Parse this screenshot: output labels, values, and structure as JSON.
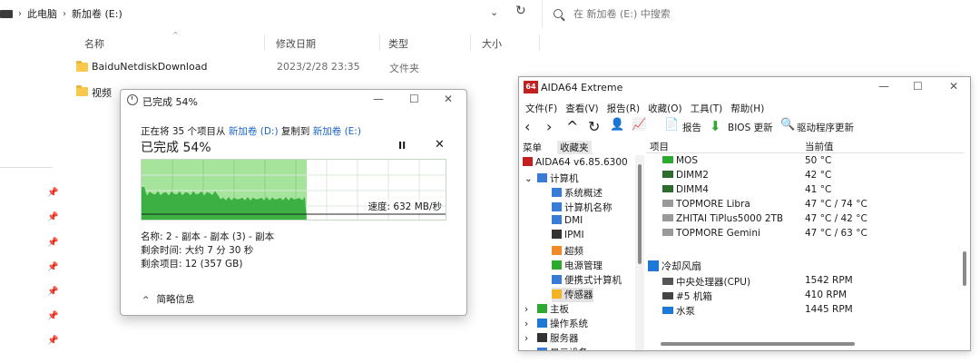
{
  "explorer": {
    "breadcrumb": [
      "此电脑",
      "新加卷 (E:)"
    ],
    "search_placeholder": "在 新加卷 (E:) 中搜索",
    "columns": {
      "name": "名称",
      "date": "修改日期",
      "type": "类型",
      "size": "大小"
    },
    "files": [
      {
        "name": "BaiduNetdiskDownload",
        "date": "2023/2/28 23:35",
        "type": "文件夹"
      },
      {
        "name": "视频",
        "date": "",
        "type": ""
      }
    ]
  },
  "copy_dialog": {
    "title": "已完成 54%",
    "desc_prefix": "正在将 35 个项目从",
    "source": "新加卷 (D:)",
    "desc_mid": "复制到",
    "dest": "新加卷 (E:)",
    "percent_label": "已完成 54%",
    "progress": 0.54,
    "speed": "速度: 632 MB/秒",
    "name_line": "名称: 2 - 副本 - 副本 (3) - 副本",
    "time_line": "剩余时间: 大约 7 分 30 秒",
    "items_line": "剩余项目: 12 (357 GB)",
    "details_label": "简略信息",
    "pause_glyph": "II",
    "stop_glyph": "✕",
    "colors": {
      "fill": "#a6e49c",
      "area": "#3cb043"
    }
  },
  "aida": {
    "logo": "64",
    "title": "AIDA64 Extreme",
    "menu": [
      "文件(F)",
      "查看(V)",
      "报告(R)",
      "收藏(O)",
      "工具(T)",
      "帮助(H)"
    ],
    "toolbar": {
      "report": "报告",
      "bios": "BIOS 更新",
      "driver": "驱动程序更新"
    },
    "tabs": {
      "menu": "菜单",
      "favorites": "收藏夹"
    },
    "tree": [
      {
        "label": "AIDA64 v6.85.6300",
        "level": 0,
        "icon": "aida-icon"
      },
      {
        "label": "计算机",
        "level": 1,
        "icon": "computer-icon",
        "expander": "⌄"
      },
      {
        "label": "系统概述",
        "level": 2,
        "icon": "system-icon"
      },
      {
        "label": "计算机名称",
        "level": 2,
        "icon": "computer-name-icon"
      },
      {
        "label": "DMI",
        "level": 2,
        "icon": "dmi-icon"
      },
      {
        "label": "IPMI",
        "level": 2,
        "icon": "ipmi-icon"
      },
      {
        "label": "超频",
        "level": 2,
        "icon": "flame-icon"
      },
      {
        "label": "电源管理",
        "level": 2,
        "icon": "power-icon"
      },
      {
        "label": "便携式计算机",
        "level": 2,
        "icon": "laptop-icon"
      },
      {
        "label": "传感器",
        "level": 2,
        "icon": "sensor-icon",
        "selected": true
      },
      {
        "label": "主板",
        "level": 1,
        "icon": "motherboard-icon",
        "expander": "›"
      },
      {
        "label": "操作系统",
        "level": 1,
        "icon": "windows-icon",
        "expander": "›"
      },
      {
        "label": "服务器",
        "level": 1,
        "icon": "server-icon",
        "expander": "›"
      },
      {
        "label": "显示设备",
        "level": 1,
        "icon": "display-icon",
        "expander": "›"
      }
    ],
    "columns": {
      "item": "项目",
      "value": "当前值"
    },
    "rows": [
      {
        "key": "MOS",
        "value": "50 °C",
        "icon": "mos-icon"
      },
      {
        "key": "DIMM2",
        "value": "42 °C",
        "icon": "memory-icon"
      },
      {
        "key": "DIMM4",
        "value": "41 °C",
        "icon": "memory-icon"
      },
      {
        "key": "TOPMORE Libra",
        "value": "47 °C / 74 °C",
        "icon": "ssd-icon"
      },
      {
        "key": "ZHITAI TiPlus5000 2TB",
        "value": "47 °C / 42 °C",
        "icon": "ssd-icon"
      },
      {
        "key": "TOPMORE Gemini",
        "value": "47 °C / 63 °C",
        "icon": "ssd-icon"
      },
      {
        "key": "冷却风扇",
        "value": "",
        "icon": "fan-icon",
        "section": true
      },
      {
        "key": "中央处理器(CPU)",
        "value": "1542 RPM",
        "icon": "cpu-icon"
      },
      {
        "key": "#5 机箱",
        "value": "410 RPM",
        "icon": "case-icon"
      },
      {
        "key": "水泵",
        "value": "1445 RPM",
        "icon": "pump-icon"
      }
    ]
  }
}
